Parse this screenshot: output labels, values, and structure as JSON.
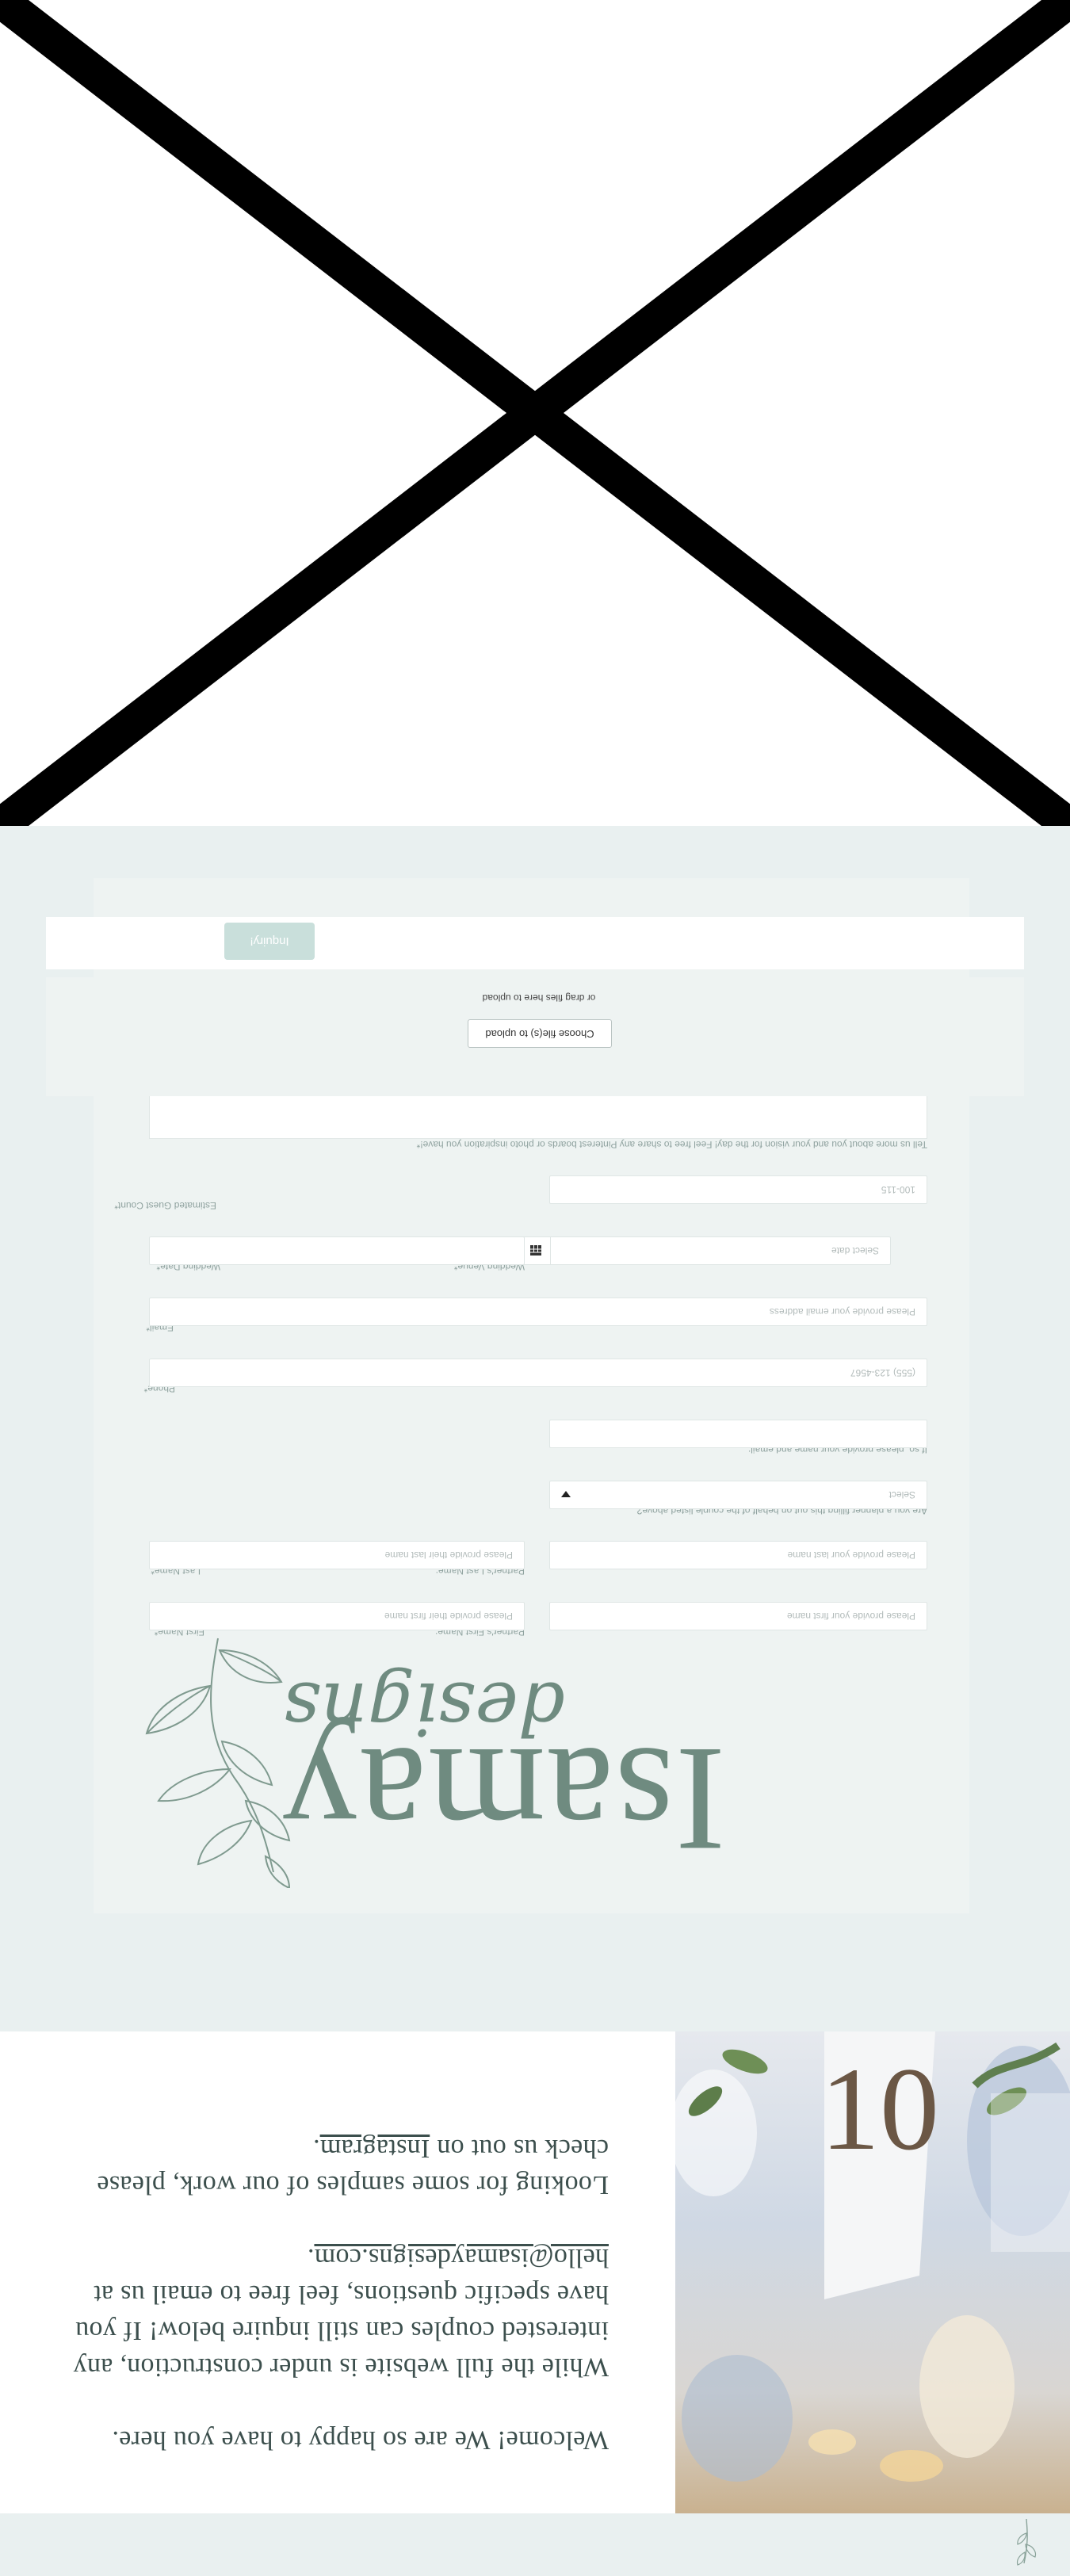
{
  "hero": {
    "welcome": "Welcome! We are so happy to have you here.",
    "construction_before": "While the full website is under construction, any interested couples can still inquire below! If you have specific questions, feel free to email us at ",
    "email": "hello@isamaydesigns.com",
    "construction_after": ".",
    "samples_before": "Looking for some samples of our work, please check us out on ",
    "instagram": "Instagram",
    "samples_after": "."
  },
  "photo": {
    "table_number": "10"
  },
  "logo": {
    "name": "Isamay",
    "tagline": "designs"
  },
  "form": {
    "first_name_label": "First Name*",
    "first_name_placeholder": "Please provide your first name",
    "partner_first_label": "Partner's First Name:",
    "partner_first_placeholder": "Please provide their first name",
    "last_name_label": "Last Name*",
    "last_name_placeholder": "Please provide your last name",
    "partner_last_label": "Partner's Last Name:",
    "partner_last_placeholder": "Please provide their last name",
    "planner_label": "Are you a planner filling this out on behalf of the couple listed above?",
    "planner_value": "Select",
    "planner_details_label": "If so, please provide your name and email:",
    "phone_label": "Phone*",
    "phone_placeholder": "(555) 123-4567",
    "email_label": "Email*",
    "email_placeholder": "Please provide your email address",
    "date_label": "Wedding Date*",
    "date_placeholder": "Select date",
    "venue_label": "Wedding Venue*",
    "guest_label": "Estimated Guest Count*",
    "guest_placeholder": "100-115",
    "vision_label": "Tell us more about you and your vision for the day! Feel free to share any Pinterest boards or photo inspiration you have!*",
    "upload_button": "Choose file(s) to upload",
    "upload_hint": "or drag files here to upload",
    "submit_label": "Inquiry!"
  },
  "colors": {
    "background": "#e9f0f0",
    "card": "#eef3f2",
    "accent": "#6f8b80",
    "text": "#3c4f4d",
    "button": "#c9dfdb"
  },
  "icons": [
    "leaf-sprig-icon",
    "calendar-icon",
    "chevron-down-icon",
    "broken-image-icon"
  ]
}
